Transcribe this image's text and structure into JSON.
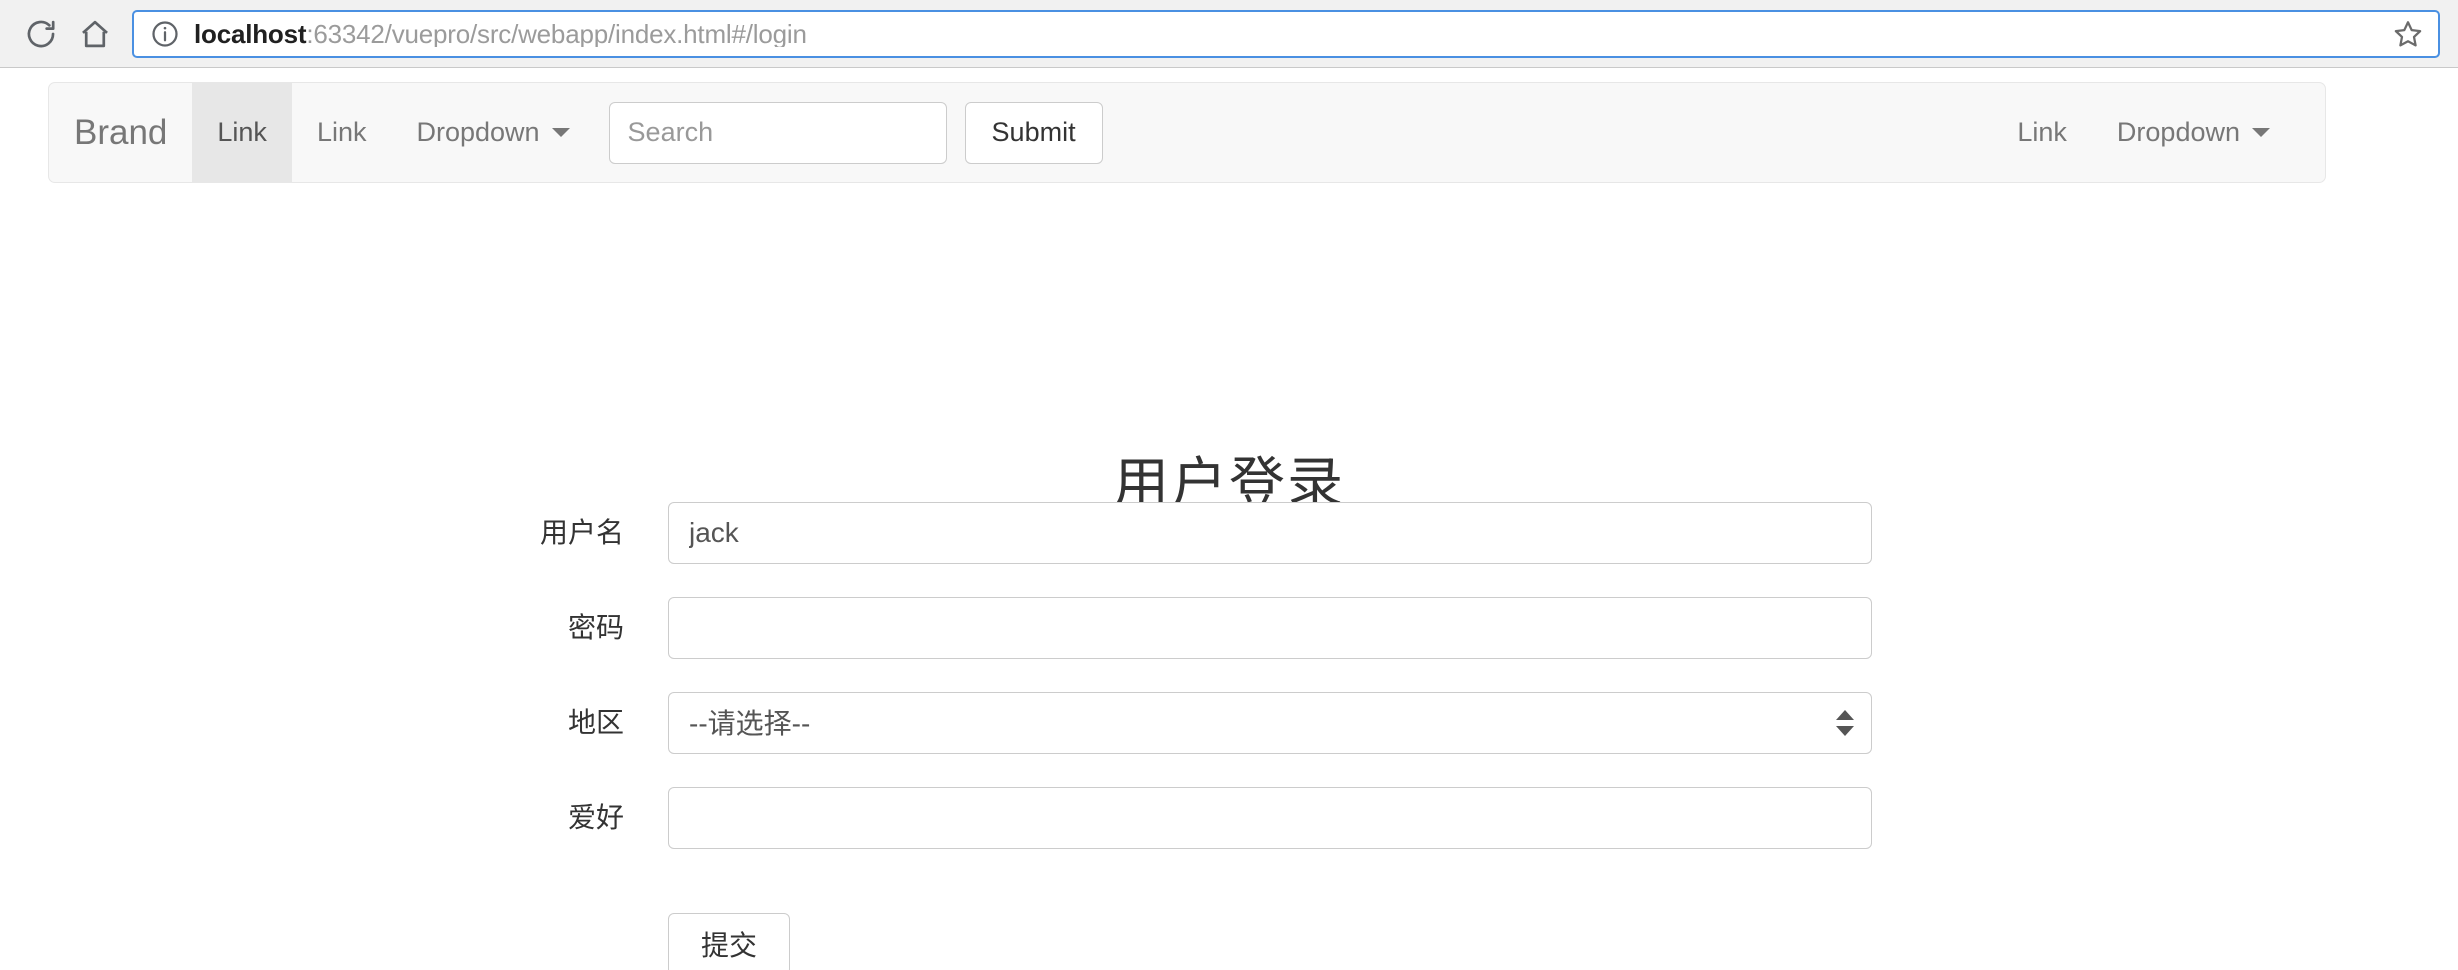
{
  "browser": {
    "reload_icon": "reload-icon",
    "home_icon": "home-icon",
    "info_icon": "info-icon",
    "bookmark_icon": "star-icon",
    "url_host": "localhost",
    "url_rest": ":63342/vuepro/src/webapp/index.html#/login"
  },
  "navbar": {
    "brand": "Brand",
    "left_items": [
      {
        "label": "Link",
        "active": true,
        "caret": false
      },
      {
        "label": "Link",
        "active": false,
        "caret": false
      },
      {
        "label": "Dropdown",
        "active": false,
        "caret": true
      }
    ],
    "right_items": [
      {
        "label": "Link",
        "active": false,
        "caret": false
      },
      {
        "label": "Dropdown",
        "active": false,
        "caret": true
      }
    ],
    "search_placeholder": "Search",
    "search_value": "",
    "submit_label": "Submit"
  },
  "login": {
    "title": "用户登录",
    "fields": {
      "username_label": "用户名",
      "username_value": "jack",
      "username_placeholder": "",
      "password_label": "密码",
      "password_value": "",
      "password_placeholder": "",
      "region_label": "地区",
      "region_selected": "--请选择--",
      "hobby_label": "爱好",
      "hobby_value": "",
      "hobby_placeholder": ""
    },
    "submit_label": "提交"
  },
  "colors": {
    "omnibox_focus": "#4a90e2",
    "navbar_bg": "#f8f8f8",
    "nav_active_bg": "#e7e7e7",
    "border": "#cccccc",
    "text": "#333333",
    "muted": "#777777"
  }
}
